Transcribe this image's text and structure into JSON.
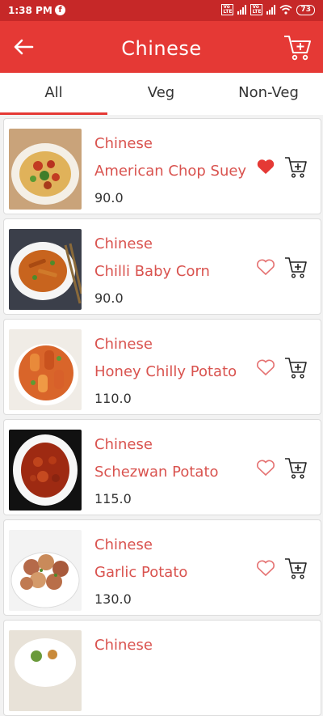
{
  "status_bar": {
    "time": "1:38 PM",
    "app_icon": "facebook-icon",
    "battery": "73"
  },
  "header": {
    "title": "Chinese"
  },
  "tabs": [
    {
      "label": "All",
      "selected": true
    },
    {
      "label": "Veg",
      "selected": false
    },
    {
      "label": "Non-Veg",
      "selected": false
    }
  ],
  "items": [
    {
      "category": "Chinese",
      "name": "American Chop Suey",
      "price": "90.0",
      "favorite": true
    },
    {
      "category": "Chinese",
      "name": "Chilli Baby Corn",
      "price": "90.0",
      "favorite": false
    },
    {
      "category": "Chinese",
      "name": "Honey Chilly Potato",
      "price": "110.0",
      "favorite": false
    },
    {
      "category": "Chinese",
      "name": "Schezwan Potato",
      "price": "115.0",
      "favorite": false
    },
    {
      "category": "Chinese",
      "name": "Garlic Potato",
      "price": "130.0",
      "favorite": false
    },
    {
      "category": "Chinese"
    }
  ],
  "colors": {
    "status_bar": "#c62828",
    "app_bar": "#e53935",
    "accent_text": "#d9534f",
    "heart_filled": "#e53935"
  }
}
